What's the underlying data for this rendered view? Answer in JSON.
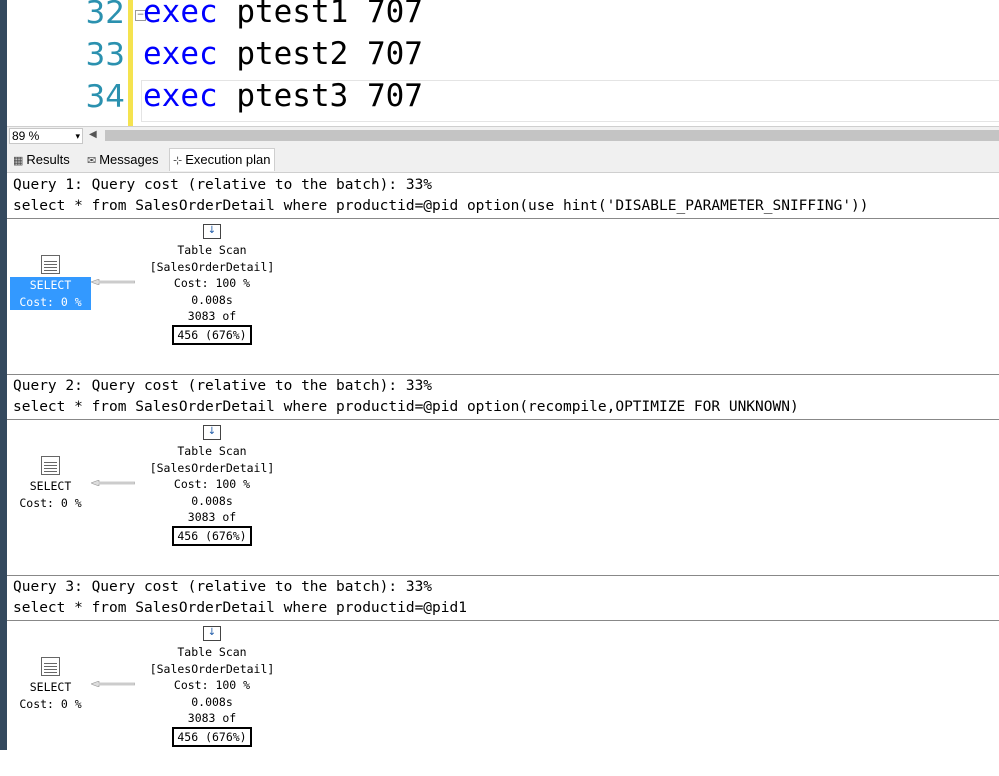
{
  "editor": {
    "lines": [
      {
        "num": "32",
        "kw": "exec",
        "rest": " ptest1 707"
      },
      {
        "num": "33",
        "kw": "exec",
        "rest": " ptest2 707"
      },
      {
        "num": "34",
        "kw": "exec",
        "rest": " ptest3 707"
      }
    ],
    "collapse_glyph": "−"
  },
  "zoom": {
    "value": "89 %",
    "arrow": "▾",
    "scroll_left": "◀"
  },
  "tabs": [
    {
      "icon": "▦",
      "label": "Results"
    },
    {
      "icon": "✉",
      "label": "Messages"
    },
    {
      "icon": "⊹",
      "label": "Execution plan"
    }
  ],
  "queries": [
    {
      "header": "Query 1: Query cost (relative to the batch): 33%",
      "sql": "select * from SalesOrderDetail where productid=@pid option(use hint('DISABLE_PARAMETER_SNIFFING'))",
      "select_op": {
        "name": "SELECT",
        "cost": "Cost: 0 %",
        "highlighted": true
      },
      "scan_op": {
        "name": "Table Scan",
        "object": "[SalesOrderDetail]",
        "cost": "Cost: 100 %",
        "time": "0.008s",
        "actual": "3083 of",
        "estimate": "456 (676%)"
      }
    },
    {
      "header": "Query 2: Query cost (relative to the batch): 33%",
      "sql": "select * from SalesOrderDetail where productid=@pid option(recompile,OPTIMIZE FOR UNKNOWN)",
      "select_op": {
        "name": "SELECT",
        "cost": "Cost: 0 %",
        "highlighted": false
      },
      "scan_op": {
        "name": "Table Scan",
        "object": "[SalesOrderDetail]",
        "cost": "Cost: 100 %",
        "time": "0.008s",
        "actual": "3083 of",
        "estimate": "456 (676%)"
      }
    },
    {
      "header": "Query 3: Query cost (relative to the batch): 33%",
      "sql": "select * from SalesOrderDetail where productid=@pid1",
      "select_op": {
        "name": "SELECT",
        "cost": "Cost: 0 %",
        "highlighted": false
      },
      "scan_op": {
        "name": "Table Scan",
        "object": "[SalesOrderDetail]",
        "cost": "Cost: 100 %",
        "time": "0.008s",
        "actual": "3083 of",
        "estimate": "456 (676%)"
      }
    }
  ],
  "colors": {
    "keyword": "#0000ff",
    "line_number": "#2b91af",
    "selection": "#3399ff",
    "change_bar": "#f5e34f"
  }
}
